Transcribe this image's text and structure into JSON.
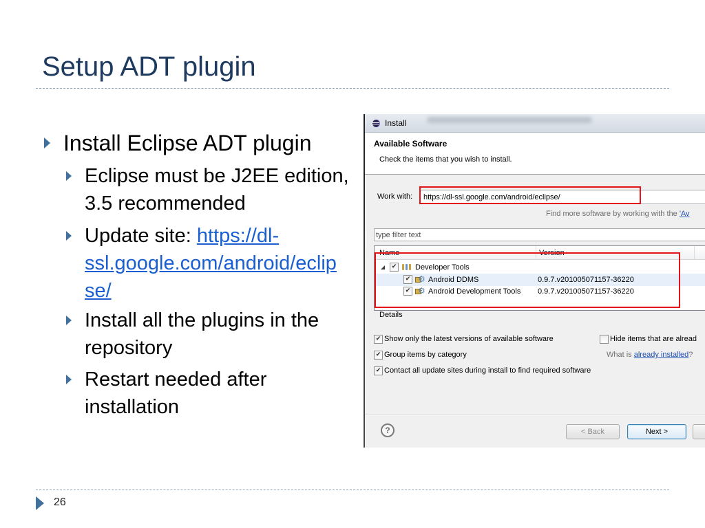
{
  "slide": {
    "title": "Setup ADT plugin",
    "main_bullet": "Install Eclipse ADT plugin",
    "sub_bullets": [
      {
        "lines": [
          "Eclipse must be J2EE edition,",
          "3.5 recommended"
        ]
      },
      {
        "prefix": "Update site:",
        "link_lines": [
          "https://dl-",
          "ssl.google.com/android/eclip",
          "se/"
        ]
      },
      {
        "lines": [
          "Install all the plugins in the",
          "repository"
        ]
      },
      {
        "lines": [
          "Restart needed after",
          "installation"
        ]
      }
    ],
    "page_number": "26",
    "bullet_icon": "triangle-bullet-icon",
    "colors": {
      "title": "#1F3A5F",
      "text": "#000000",
      "bullet_marker": "#41719C",
      "link": "#1A5FD1",
      "divider": "#8FA6B9"
    }
  },
  "dialog": {
    "window_title": "Install",
    "window_icon": "eclipse-icon",
    "heading": "Available Software",
    "instruction": "Check the items that you wish to install.",
    "work_with": {
      "label": "Work with:",
      "value": "https://dl-ssl.google.com/android/eclipse/"
    },
    "find_more": {
      "text": "Find more software by working with the",
      "link": "'Av"
    },
    "filter": {
      "placeholder": "type filter text"
    },
    "table": {
      "columns": {
        "name": "Name",
        "version": "Version"
      },
      "category": {
        "name": "Developer Tools",
        "checked": true,
        "expanded": true,
        "icon": "category-icon"
      },
      "items": [
        {
          "name": "Android DDMS",
          "version": "0.9.7.v201005071157-36220",
          "checked": true,
          "icon": "feature-icon"
        },
        {
          "name": "Android Development Tools",
          "version": "0.9.7.v201005071157-36220",
          "checked": true,
          "icon": "feature-icon"
        }
      ]
    },
    "details_label": "Details",
    "options": [
      {
        "label": "Show only the latest versions of available software",
        "checked": true
      },
      {
        "label": "Group items by category",
        "checked": true
      },
      {
        "label": "Contact all update sites during install to find required software",
        "checked": true
      }
    ],
    "hide_installed": {
      "label": "Hide items that are alread",
      "checked": false
    },
    "already_installed": {
      "prefix": "What is",
      "link": "already installed",
      "suffix": "?"
    },
    "buttons": {
      "back": "< Back",
      "next": "Next >"
    },
    "help_icon": "help-icon",
    "annotation_color": "#E3151B"
  }
}
